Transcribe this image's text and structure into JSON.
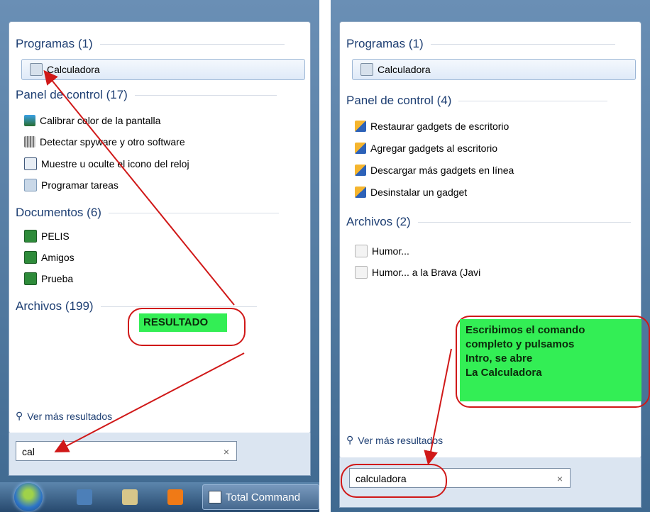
{
  "left": {
    "categories": [
      {
        "label": "Programas (1)"
      },
      {
        "label": "Panel de control (17)"
      },
      {
        "label": "Documentos (6)"
      },
      {
        "label": "Archivos (199)"
      }
    ],
    "programs": [
      {
        "label": "Calculadora",
        "icon": "calculator-icon"
      }
    ],
    "control_panel": [
      {
        "label": "Calibrar color de la pantalla",
        "icon": "monitor-icon"
      },
      {
        "label": "Detectar spyware y otro software",
        "icon": "defender-icon"
      },
      {
        "label": "Muestre u oculte el icono del reloj",
        "icon": "taskbar-icon"
      },
      {
        "label": "Programar tareas",
        "icon": "scheduler-icon"
      }
    ],
    "documents": [
      {
        "label": "PELIS",
        "icon": "excel-icon"
      },
      {
        "label": "Amigos",
        "icon": "excel-icon"
      },
      {
        "label": "Prueba",
        "icon": "excel-icon"
      }
    ],
    "more_results": "Ver más resultados",
    "search_value": "cal",
    "clear": "×",
    "taskbar_item": "Total Command",
    "annotation": "RESULTADO"
  },
  "right": {
    "categories": [
      {
        "label": "Programas (1)"
      },
      {
        "label": "Panel de control (4)"
      },
      {
        "label": "Archivos (2)"
      }
    ],
    "programs": [
      {
        "label": "Calculadora",
        "icon": "calculator-icon"
      }
    ],
    "control_panel": [
      {
        "label": "Restaurar gadgets de escritorio",
        "icon": "gadget-icon"
      },
      {
        "label": "Agregar gadgets al escritorio",
        "icon": "gadget-icon"
      },
      {
        "label": "Descargar más gadgets en línea",
        "icon": "gadget-icon"
      },
      {
        "label": "Desinstalar un gadget",
        "icon": "gadget-icon"
      }
    ],
    "files": [
      {
        "label": "Humor...",
        "icon": "mail-icon"
      },
      {
        "label": "Humor... a la Brava (Javi",
        "icon": "mail-icon"
      }
    ],
    "more_results": "Ver más resultados",
    "search_value": "calculadora",
    "clear": "×",
    "annotation_lines": [
      "Escribimos el comando",
      "completo y pulsamos",
      "Intro, se abre",
      "La Calculadora"
    ]
  },
  "colors": {
    "annotation_bg": "#33ee55",
    "arrow": "#d01818",
    "category": "#1e3f73"
  }
}
